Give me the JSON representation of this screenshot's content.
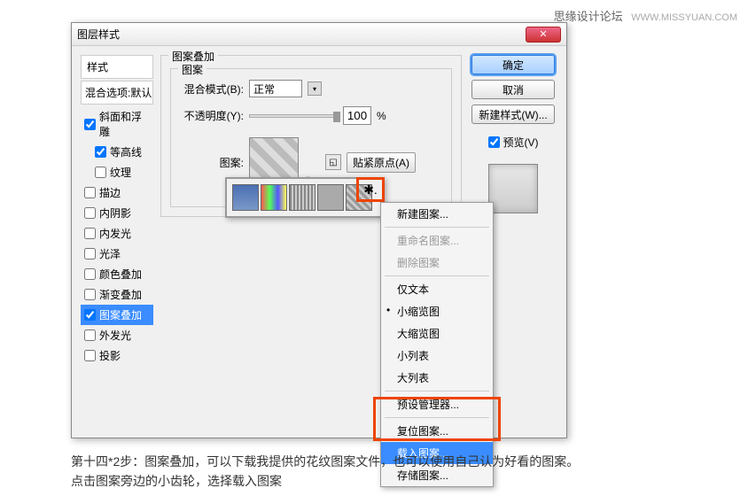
{
  "watermark": {
    "name": "思缘设计论坛",
    "url": "WWW.MISSYUAN.COM"
  },
  "dialog": {
    "title": "图层样式",
    "stylesHeader": "样式",
    "blendOptions": "混合选项:默认",
    "styleItems": [
      {
        "label": "斜面和浮雕",
        "checked": true,
        "indent": false
      },
      {
        "label": "等高线",
        "checked": true,
        "indent": true
      },
      {
        "label": "纹理",
        "checked": false,
        "indent": true
      },
      {
        "label": "描边",
        "checked": false,
        "indent": false
      },
      {
        "label": "内阴影",
        "checked": false,
        "indent": false
      },
      {
        "label": "内发光",
        "checked": false,
        "indent": false
      },
      {
        "label": "光泽",
        "checked": false,
        "indent": false
      },
      {
        "label": "颜色叠加",
        "checked": false,
        "indent": false
      },
      {
        "label": "渐变叠加",
        "checked": false,
        "indent": false
      },
      {
        "label": "图案叠加",
        "checked": true,
        "indent": false,
        "active": true
      },
      {
        "label": "外发光",
        "checked": false,
        "indent": false
      },
      {
        "label": "投影",
        "checked": false,
        "indent": false
      }
    ],
    "panelTitle": "图案叠加",
    "innerTitle": "图案",
    "blendModeLabel": "混合模式(B):",
    "blendModeValue": "正常",
    "opacityLabel": "不透明度(Y):",
    "opacityValue": "100",
    "opacityUnit": "%",
    "patternLabel": "图案:",
    "snapBtn": "贴紧原点(A)",
    "buttons": {
      "ok": "确定",
      "cancel": "取消",
      "newStyle": "新建样式(W)..."
    },
    "previewLabel": "预览(V)"
  },
  "contextMenu": {
    "items": [
      {
        "label": "新建图案...",
        "type": "item"
      },
      {
        "type": "sep"
      },
      {
        "label": "重命名图案...",
        "type": "item",
        "disabled": true
      },
      {
        "label": "删除图案",
        "type": "item",
        "disabled": true
      },
      {
        "type": "sep"
      },
      {
        "label": "仅文本",
        "type": "item"
      },
      {
        "label": "小缩览图",
        "type": "item",
        "checked": true
      },
      {
        "label": "大缩览图",
        "type": "item"
      },
      {
        "label": "小列表",
        "type": "item"
      },
      {
        "label": "大列表",
        "type": "item"
      },
      {
        "type": "sep"
      },
      {
        "label": "预设管理器...",
        "type": "item"
      },
      {
        "type": "sep"
      },
      {
        "label": "复位图案...",
        "type": "item"
      },
      {
        "label": "载入图案...",
        "type": "item",
        "highlighted": true
      },
      {
        "label": "存储图案...",
        "type": "item"
      }
    ]
  },
  "caption": {
    "line1": "第十四*2步：图案叠加，可以下载我提供的花纹图案文件，也可以使用自己认为好看的图案。",
    "line2": "点击图案旁边的小齿轮，选择载入图案"
  }
}
